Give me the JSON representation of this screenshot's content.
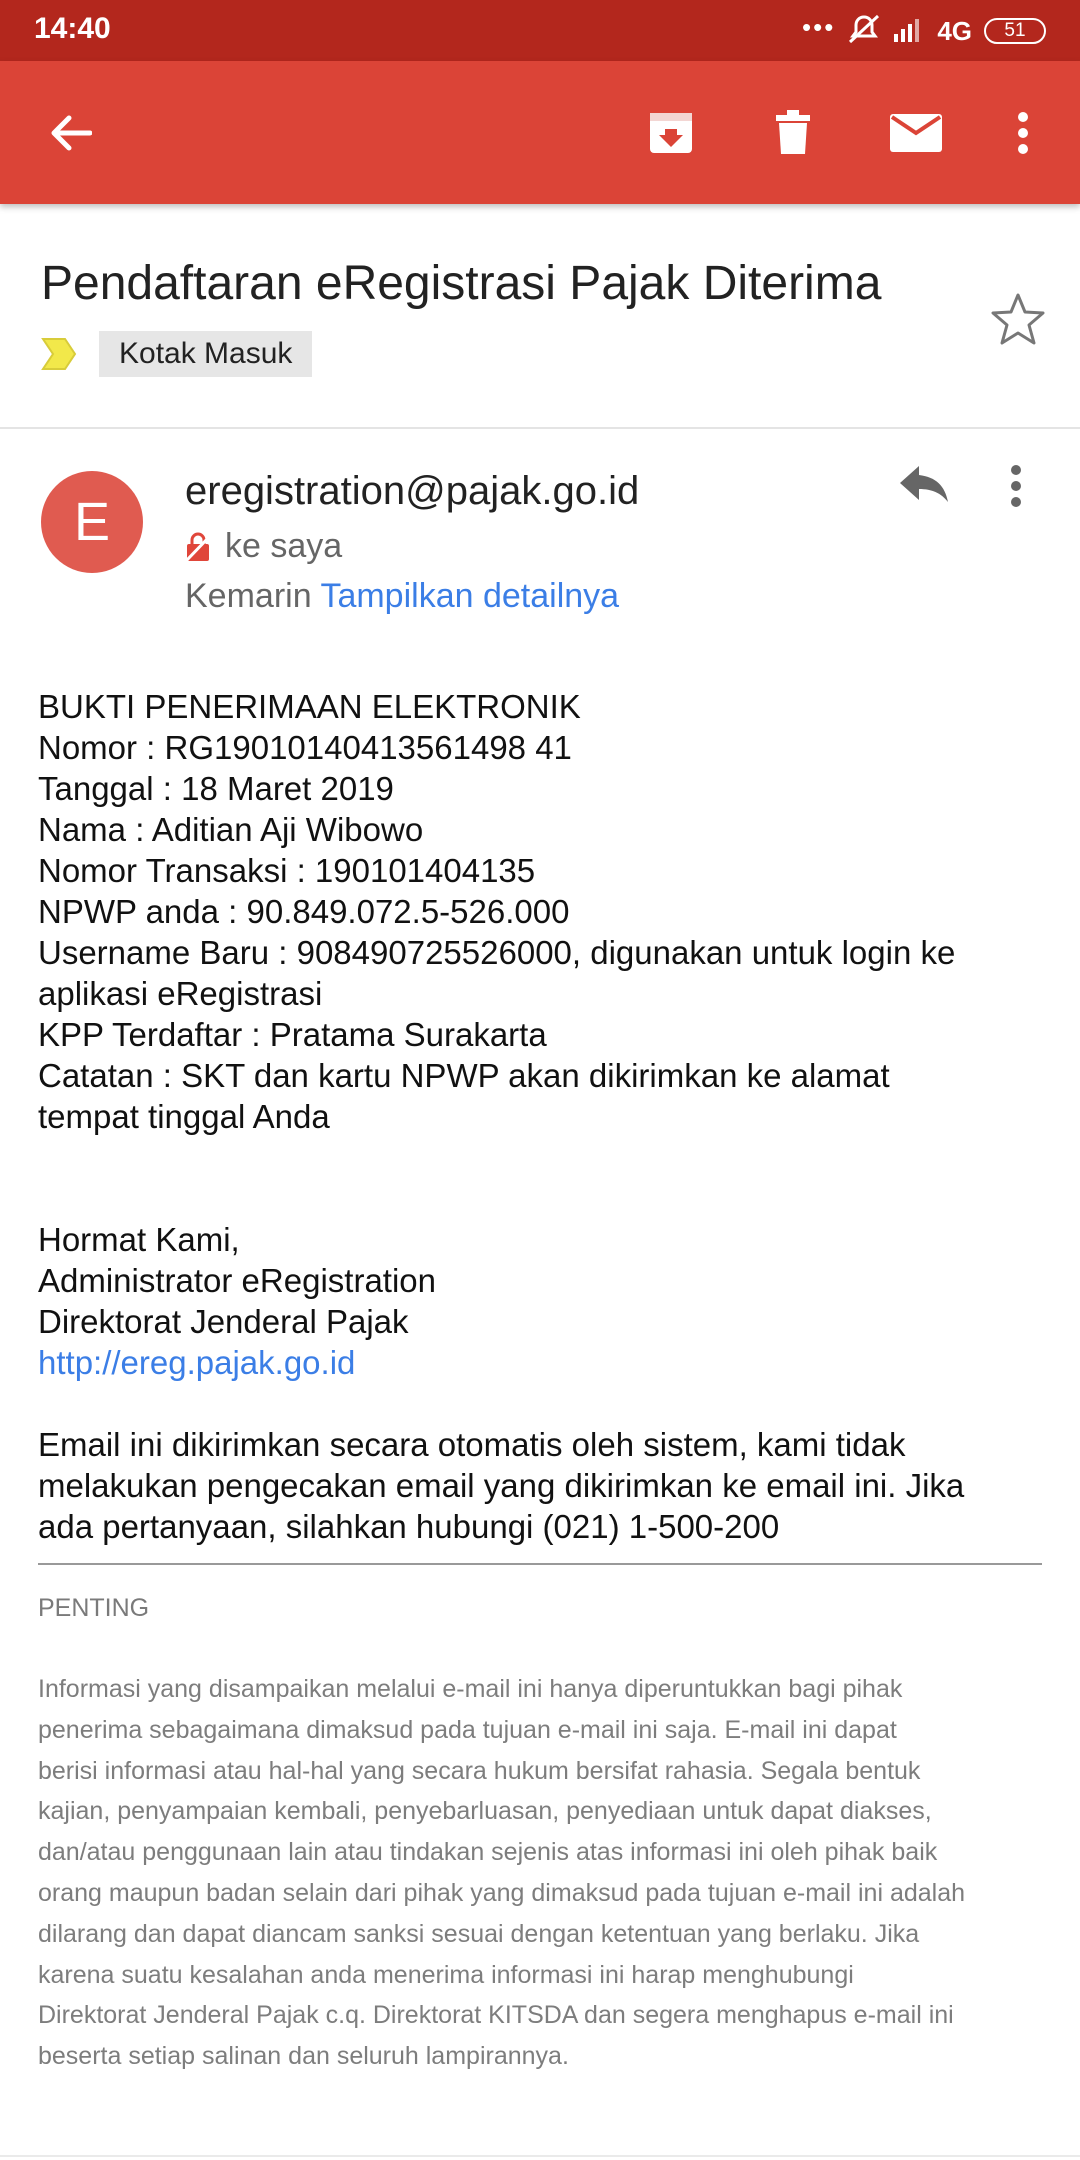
{
  "status_bar": {
    "time": "14:40",
    "dots": "•••",
    "network": "4G",
    "battery": "51"
  },
  "toolbar": {
    "icons": [
      "back-arrow-icon",
      "archive-icon",
      "delete-icon",
      "mark-unread-icon",
      "more-vert-icon"
    ],
    "color": "#db4437"
  },
  "email": {
    "subject": "Pendaftaran eRegistrasi Pajak Diterima",
    "label": "Kotak Masuk",
    "sender": {
      "initial": "E",
      "email": "eregistration@pajak.go.id",
      "to": "ke saya",
      "date": "Kemarin",
      "details_link": "Tampilkan detailnya"
    },
    "body_lines": [
      "BUKTI PENERIMAAN ELEKTRONIK",
      "Nomor : RG19010140413561498 41",
      "Tanggal : 18 Maret 2019",
      "Nama : Aditian Aji Wibowo",
      "Nomor Transaksi : 190101404135",
      "NPWP anda : 90.849.072.5-526.000",
      "Username Baru : 908490725526000, digunakan untuk login ke",
      "aplikasi eRegistrasi",
      "KPP Terdaftar : Pratama Surakarta",
      "Catatan : SKT dan kartu NPWP akan dikirimkan ke alamat",
      "tempat tinggal Anda"
    ],
    "signoff": [
      "Hormat Kami,",
      "Administrator eRegistration",
      "Direktorat Jenderal Pajak"
    ],
    "signoff_link": "http://ereg.pajak.go.id",
    "auto_note": [
      "Email ini dikirimkan secara otomatis oleh sistem, kami tidak",
      "melakukan pengecakan email yang dikirimkan ke email ini. Jika",
      "ada pertanyaan, silahkan hubungi (021) 1-500-200"
    ],
    "penting": "PENTING",
    "disclaimer": [
      "Informasi yang disampaikan melalui e-mail ini hanya diperuntukkan bagi pihak",
      "penerima sebagaimana dimaksud pada tujuan e-mail ini saja. E-mail ini dapat",
      "berisi informasi atau hal-hal yang secara hukum bersifat rahasia. Segala bentuk",
      "kajian, penyampaian kembali, penyebarluasan, penyediaan untuk dapat diakses,",
      "dan/atau penggunaan lain atau tindakan sejenis atas informasi ini oleh pihak baik",
      "orang maupun badan selain dari pihak yang dimaksud pada tujuan e-mail ini adalah",
      "dilarang dan dapat diancam sanksi sesuai dengan ketentuan yang berlaku. Jika",
      "karena suatu kesalahan anda menerima informasi ini harap menghubungi",
      "Direktorat Jenderal Pajak c.q. Direktorat KITSDA dan segera menghapus e-mail ini",
      "beserta setiap salinan dan seluruh lampirannya."
    ]
  }
}
